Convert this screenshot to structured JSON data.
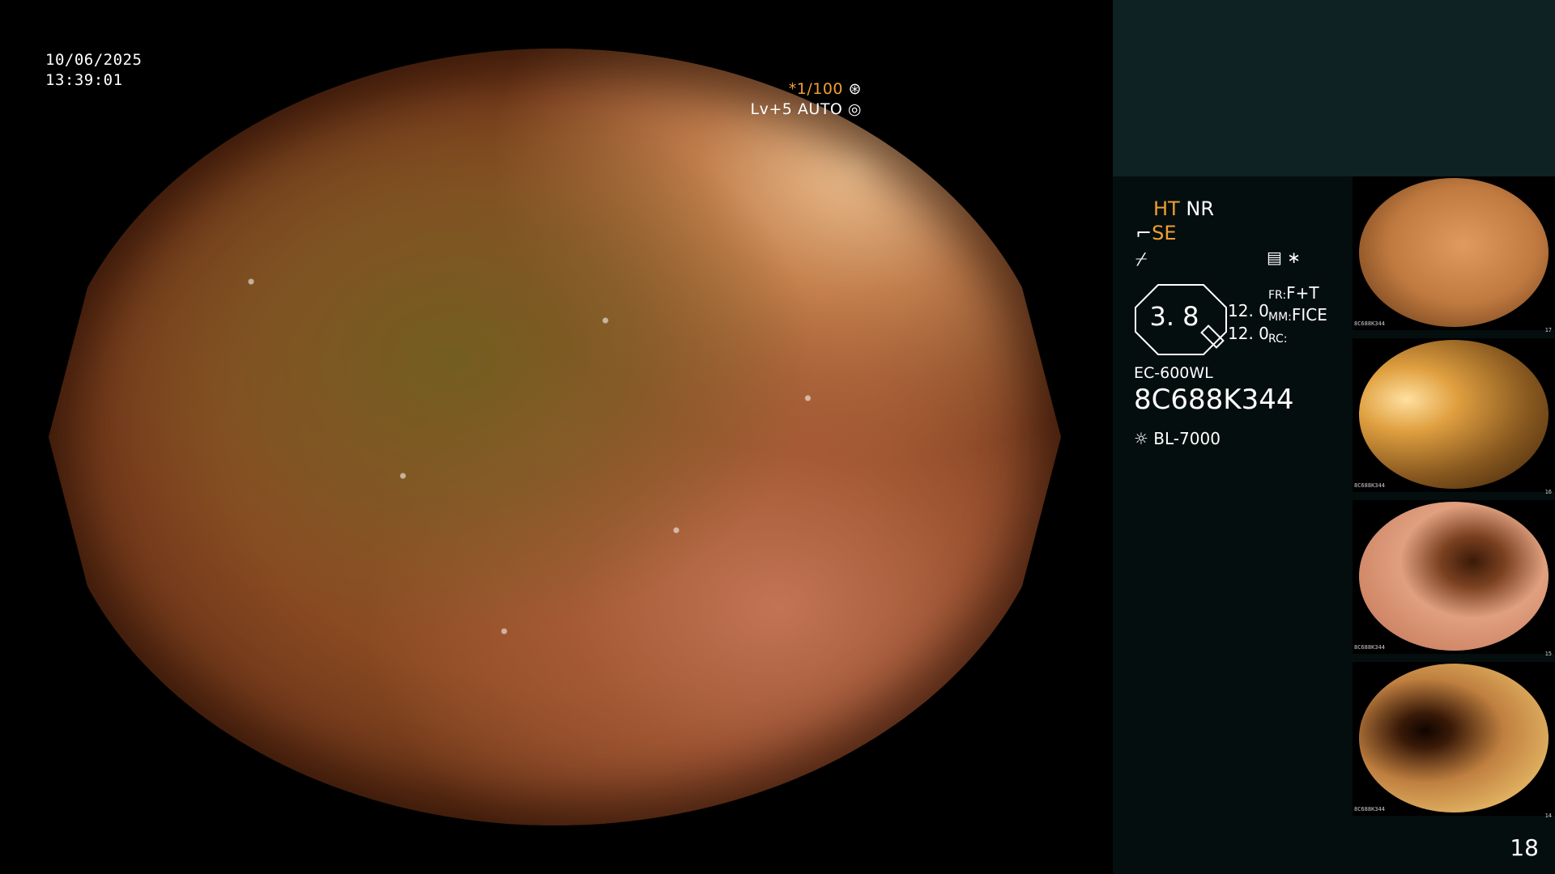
{
  "overlay": {
    "date": "10/06/2025",
    "time": "13:39:01",
    "shutter": "*1/100",
    "level": "Lv+5 AUTO"
  },
  "settings": {
    "ht": "HT",
    "nr": "NR",
    "se": "SE",
    "zoom_value": "3. 8",
    "val1": "12. 0",
    "val2": "12. 0",
    "fr_label": "FR:",
    "fr_value": "F+T",
    "mm_label": "MM:",
    "mm_value": "FICE",
    "rc_label": "RC:",
    "scope_model": "EC-600WL",
    "serial": "8C688K344",
    "light_source": "BL-7000"
  },
  "thumbnails": [
    {
      "index": "17",
      "serial": "8C688K344"
    },
    {
      "index": "16",
      "serial": "8C688K344"
    },
    {
      "index": "15",
      "serial": "8C688K344"
    },
    {
      "index": "14",
      "serial": "8C688K344"
    }
  ],
  "page_number": "18",
  "colors": {
    "accent_orange": "#f0a030",
    "panel_teal": "#0e2224",
    "panel_dark": "#050e0e"
  }
}
